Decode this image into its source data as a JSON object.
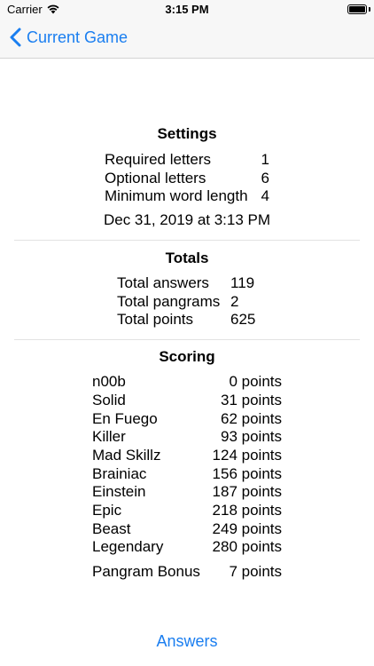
{
  "status_bar": {
    "carrier": "Carrier",
    "time": "3:15 PM"
  },
  "nav": {
    "back_label": "Current Game"
  },
  "settings": {
    "title": "Settings",
    "rows": [
      {
        "label": "Required letters",
        "value": "1"
      },
      {
        "label": "Optional letters",
        "value": "6"
      },
      {
        "label": "Minimum word length",
        "value": "4"
      }
    ],
    "date": "Dec 31, 2019 at 3:13 PM"
  },
  "totals": {
    "title": "Totals",
    "rows": [
      {
        "label": "Total answers",
        "value": "119"
      },
      {
        "label": "Total pangrams",
        "value": "2"
      },
      {
        "label": "Total points",
        "value": "625"
      }
    ]
  },
  "scoring": {
    "title": "Scoring",
    "rows": [
      {
        "label": "n00b",
        "value": "0 points"
      },
      {
        "label": "Solid",
        "value": "31 points"
      },
      {
        "label": "En Fuego",
        "value": "62 points"
      },
      {
        "label": "Killer",
        "value": "93 points"
      },
      {
        "label": "Mad Skillz",
        "value": "124 points"
      },
      {
        "label": "Brainiac",
        "value": "156 points"
      },
      {
        "label": "Einstein",
        "value": "187 points"
      },
      {
        "label": "Epic",
        "value": "218 points"
      },
      {
        "label": "Beast",
        "value": "249 points"
      },
      {
        "label": "Legendary",
        "value": "280 points"
      }
    ],
    "bonus": {
      "label": "Pangram Bonus",
      "value": "7 points"
    }
  },
  "footer": {
    "answers_label": "Answers"
  },
  "colors": {
    "accent": "#1a7ef0"
  }
}
